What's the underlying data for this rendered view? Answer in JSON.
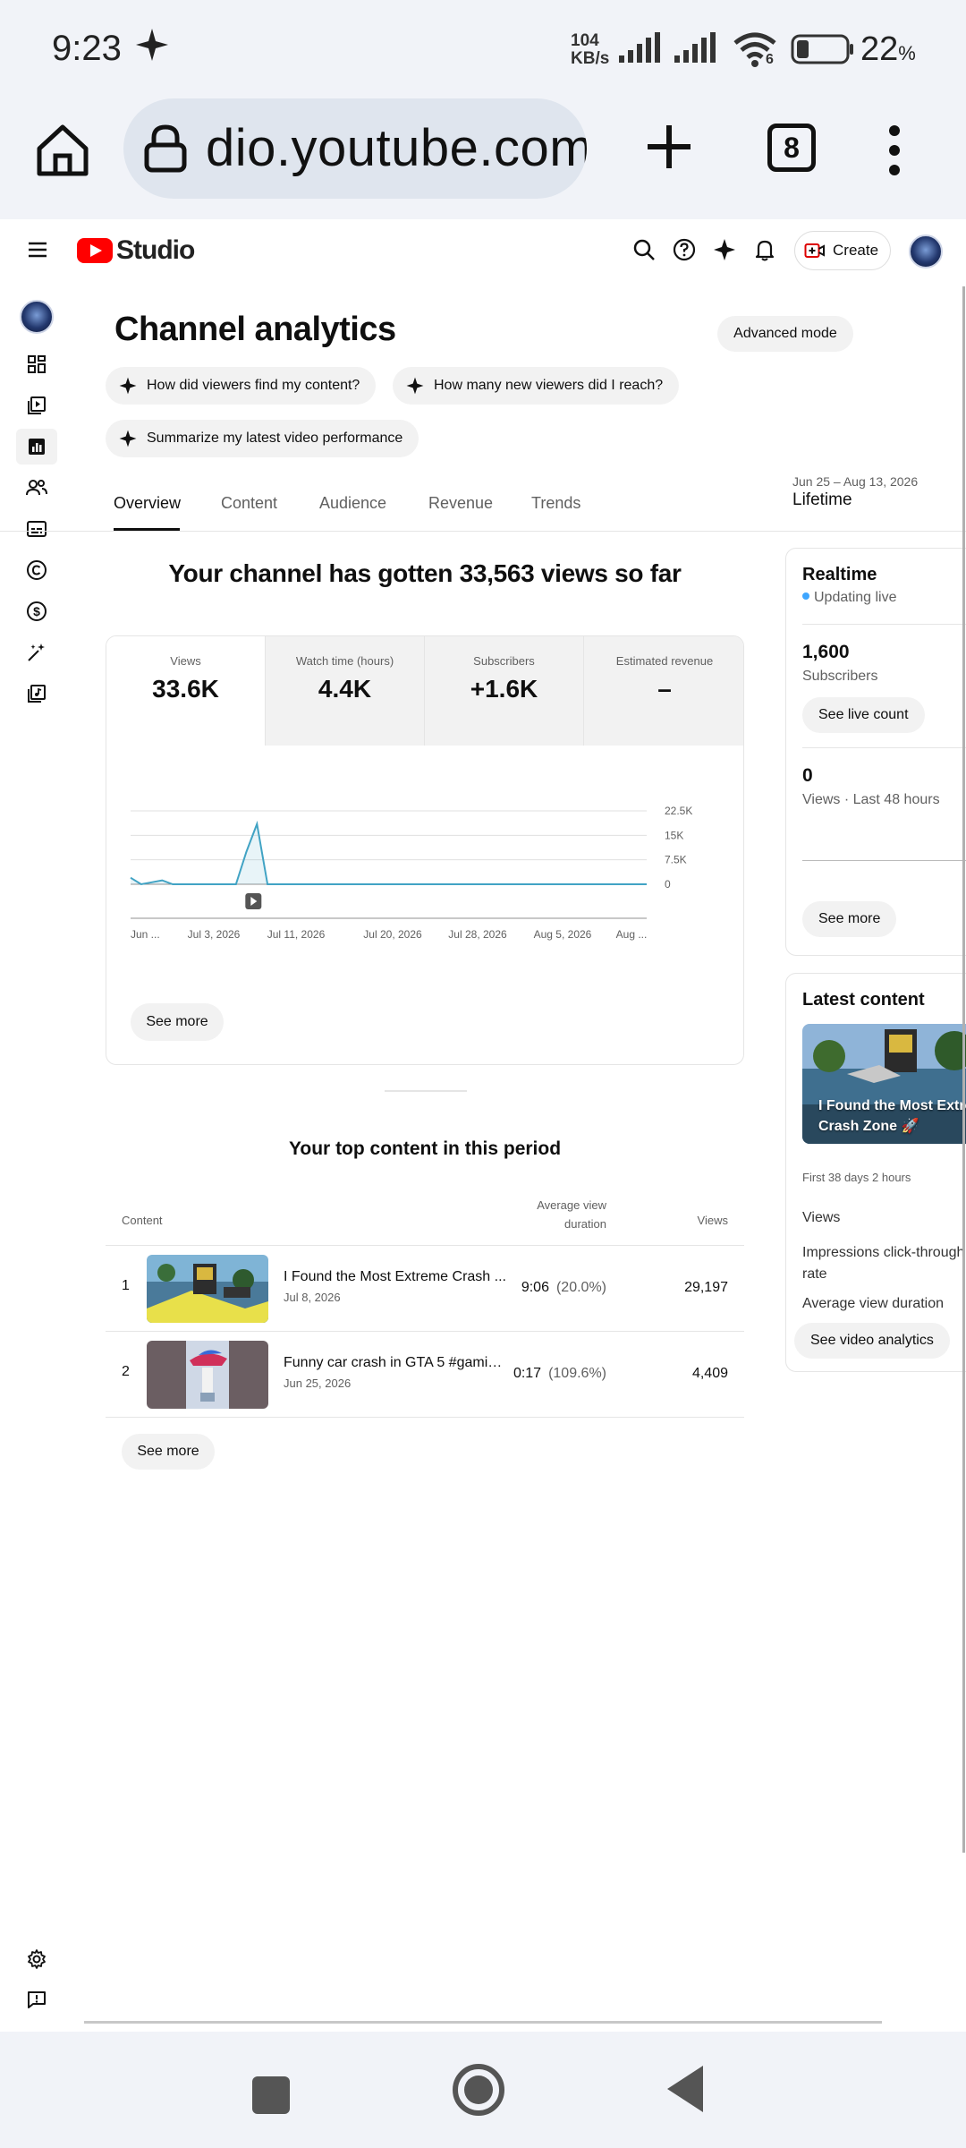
{
  "status_bar": {
    "time": "9:23",
    "net_speed_value": "104",
    "net_speed_unit": "KB/s",
    "wifi_badge": "6",
    "battery": "22",
    "battery_unit": "%"
  },
  "browser": {
    "url": "dio.youtube.com",
    "tab_count": "8"
  },
  "header": {
    "logo_text": "Studio",
    "create_label": "Create"
  },
  "page": {
    "title": "Channel analytics",
    "advanced_mode_label": "Advanced mode",
    "prompt_chips": [
      "How did viewers find my content?",
      "How many new viewers did I reach?",
      "Summarize my latest video performance"
    ],
    "tabs": [
      "Overview",
      "Content",
      "Audience",
      "Revenue",
      "Trends"
    ],
    "active_tab": "Overview",
    "date_range": "Jun 25 – Aug 13, 2026",
    "date_range_label": "Lifetime",
    "headline": "Your channel has gotten 33,563 views so far"
  },
  "metrics": [
    {
      "label": "Views",
      "value": "33.6K"
    },
    {
      "label": "Watch time (hours)",
      "value": "4.4K"
    },
    {
      "label": "Subscribers",
      "value": "+1.6K"
    },
    {
      "label": "Estimated revenue",
      "value": "–"
    }
  ],
  "chart_data": {
    "type": "line",
    "x_tick_labels": [
      "Jun ...",
      "Jul 3, 2026",
      "Jul 11, 2026",
      "Jul 20, 2026",
      "Jul 28, 2026",
      "Aug 5, 2026",
      "Aug ..."
    ],
    "y_tick_labels": [
      "22.5K",
      "15K",
      "7.5K",
      "0"
    ],
    "ylim": [
      0,
      22500
    ],
    "y_ticks": [
      22500,
      15000,
      7500,
      0
    ],
    "series": [
      {
        "values": [
          2000,
          0,
          600,
          1200,
          0,
          0,
          0,
          0,
          0,
          0,
          0,
          10000,
          18500,
          0,
          0,
          0,
          0,
          0,
          0,
          0,
          0,
          0,
          0,
          0,
          0,
          0,
          0,
          0,
          0,
          0,
          0,
          0,
          0,
          0,
          0,
          0,
          0,
          0,
          0,
          0,
          0,
          0,
          0,
          0,
          0,
          0,
          0,
          0,
          0,
          0
        ]
      }
    ],
    "grid": true,
    "color": "#41a3c4"
  },
  "overview_see_more": "See more",
  "top_content": {
    "title": "Your top content in this period",
    "col_content": "Content",
    "col_avd": "Average view duration",
    "col_views": "Views",
    "rows": [
      {
        "rank": "1",
        "title": "I Found the Most Extreme Crash ...",
        "date": "Jul 8, 2026",
        "avd": "9:06",
        "avd_pct": "(20.0%)",
        "views": "29,197"
      },
      {
        "rank": "2",
        "title": "Funny car crash in GTA 5 #gamin...",
        "date": "Jun 25, 2026",
        "avd": "0:17",
        "avd_pct": "(109.6%)",
        "views": "4,409"
      }
    ],
    "see_more": "See more"
  },
  "realtime": {
    "title": "Realtime",
    "status": "Updating live",
    "subs_value": "1,600",
    "subs_label": "Subscribers",
    "live_count_btn": "See live count",
    "views_value": "0",
    "views_label": "Views · Last 48 hours",
    "see_more": "See more"
  },
  "latest": {
    "title": "Latest content",
    "thumb_text": "I Found the Most Extreme Crash Zone 🚀",
    "period": "First 38 days 2 hours",
    "metric1": "Views",
    "metric2": "Impressions click-through rate",
    "metric3": "Average view duration",
    "btn": "See video analytics"
  }
}
